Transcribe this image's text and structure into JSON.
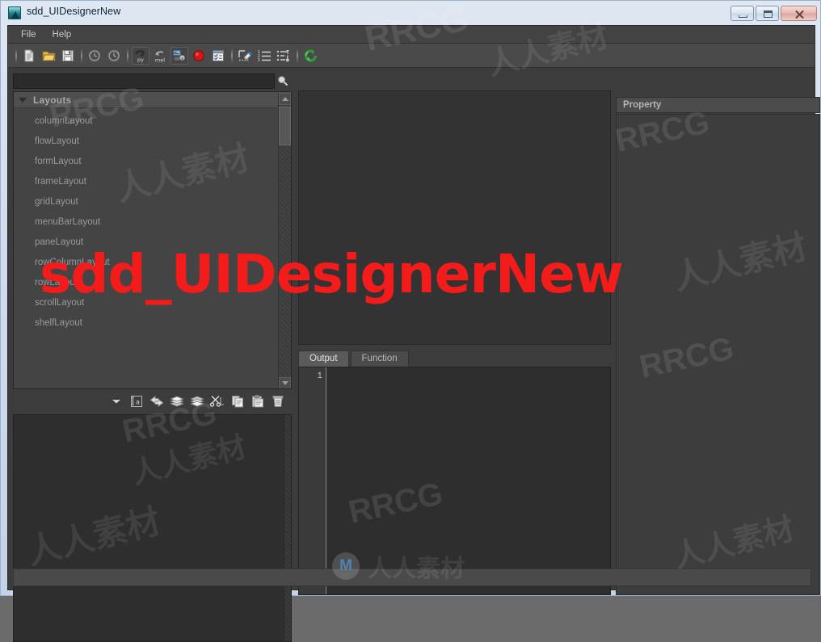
{
  "window": {
    "title": "sdd_UIDesignerNew",
    "icon": "maya-app-icon",
    "buttons": {
      "minimize": "minimize-button",
      "maximize": "maximize-button",
      "close": "close-button"
    }
  },
  "menubar": {
    "items": [
      {
        "label": "File"
      },
      {
        "label": "Help"
      }
    ]
  },
  "toolbar": {
    "buttons": [
      {
        "icon": "new-document-icon",
        "name": "new-file-button",
        "framed": false
      },
      {
        "icon": "open-folder-icon",
        "name": "open-file-button",
        "framed": false
      },
      {
        "icon": "save-disk-icon",
        "name": "save-file-button",
        "framed": false
      },
      {
        "icon": "undo-clock-icon",
        "name": "undo-button",
        "framed": false
      },
      {
        "icon": "redo-clock-icon",
        "name": "redo-button",
        "framed": false
      },
      {
        "icon": "python-script-icon",
        "name": "python-button",
        "framed": true,
        "label": "py"
      },
      {
        "icon": "mel-script-icon",
        "name": "mel-button",
        "framed": false,
        "label": "mel"
      },
      {
        "icon": "ui-build-icon",
        "name": "build-ui-button",
        "framed": true
      },
      {
        "icon": "record-dot-icon",
        "name": "record-button",
        "framed": false
      },
      {
        "icon": "checklist-icon",
        "name": "checklist-button",
        "framed": false
      },
      {
        "icon": "eraser-select-icon",
        "name": "clear-button",
        "framed": false
      },
      {
        "icon": "numbered-list-icon",
        "name": "ordered-list-button",
        "framed": false
      },
      {
        "icon": "settings-list-icon",
        "name": "options-button",
        "framed": false
      },
      {
        "icon": "refresh-green-icon",
        "name": "refresh-button",
        "framed": false
      }
    ]
  },
  "search": {
    "value": "",
    "placeholder": "",
    "icon": "search-icon"
  },
  "tree": {
    "group": {
      "label": "Layouts",
      "expanded": true,
      "chevron": "chevron-down-icon"
    },
    "items": [
      {
        "label": "columnLayout"
      },
      {
        "label": "flowLayout"
      },
      {
        "label": "formLayout"
      },
      {
        "label": "frameLayout"
      },
      {
        "label": "gridLayout"
      },
      {
        "label": "menuBarLayout"
      },
      {
        "label": "paneLayout"
      },
      {
        "label": "rowColumnLayout"
      },
      {
        "label": "rowLayout"
      },
      {
        "label": "scrollLayout"
      },
      {
        "label": "shelfLayout"
      }
    ],
    "scrollbar": {
      "up_arrow": "scroll-up-arrow-icon",
      "down_arrow": "scroll-down-arrow-icon"
    }
  },
  "mid_toolbar": {
    "buttons": [
      {
        "icon": "chevron-down-icon",
        "name": "tool-menu-dropdown"
      },
      {
        "icon": "text-field-icon",
        "name": "rename-button"
      },
      {
        "icon": "arrows-swap-icon",
        "name": "swap-button"
      },
      {
        "icon": "layers-up-icon",
        "name": "move-up-button"
      },
      {
        "icon": "layers-down-icon",
        "name": "move-down-button"
      },
      {
        "icon": "cut-scissors-icon",
        "name": "cut-button"
      },
      {
        "icon": "copy-icon",
        "name": "copy-button"
      },
      {
        "icon": "paste-icon",
        "name": "paste-button"
      },
      {
        "icon": "trash-icon",
        "name": "delete-button"
      }
    ]
  },
  "center": {
    "canvas": {
      "name": "design-canvas",
      "content": ""
    },
    "tabs": [
      {
        "label": "Output",
        "active": true
      },
      {
        "label": "Function",
        "active": false
      }
    ],
    "editor": {
      "line_numbers": "1",
      "content": ""
    }
  },
  "property_panel": {
    "title": "Property",
    "content": ""
  },
  "statusbar": {
    "text": ""
  },
  "watermarks": {
    "overlay_title": "sdd_UIDesignerNew",
    "brand": "RRCG",
    "brand_cn": "人人素材",
    "logo_letter": "M",
    "logo_text": "人人素材"
  },
  "colors": {
    "accent_red": "#f41b1b",
    "panel_bg": "#3c3c3c",
    "dark_bg": "#2e2e2e",
    "toolbar_bg": "#4a4a4a",
    "text": "#c9c9c9",
    "title_frame": "#cfdced"
  }
}
